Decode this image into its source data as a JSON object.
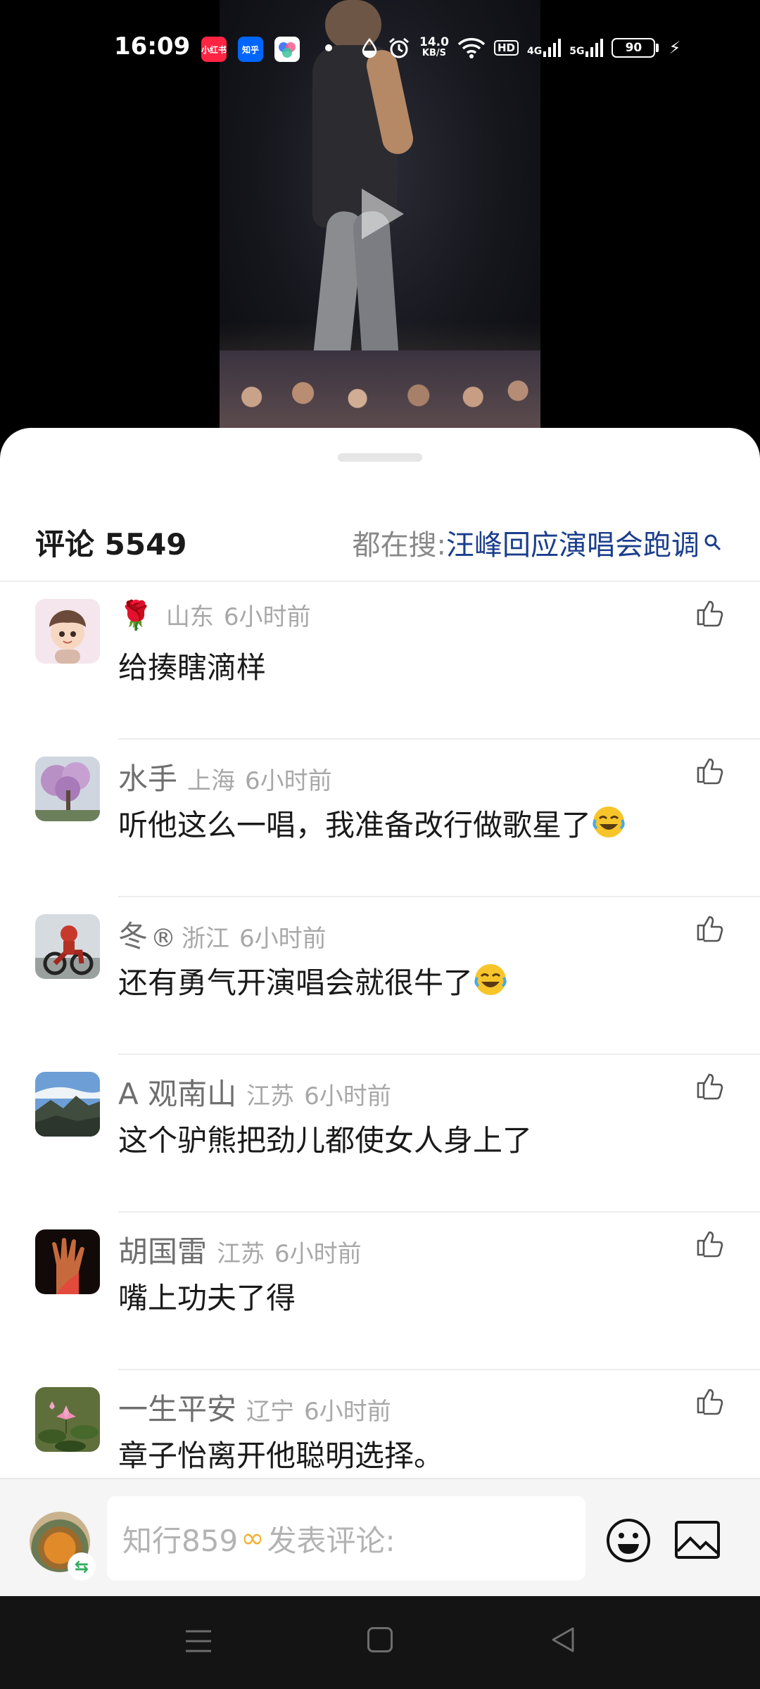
{
  "status_bar": {
    "time": "16:09",
    "apps": [
      {
        "icon": "xiaohongshu-icon",
        "label": "小红书",
        "color": "#ff2442"
      },
      {
        "icon": "zhihu-icon",
        "label": "知乎",
        "color": "#0066ff"
      },
      {
        "icon": "app-icon",
        "label": "",
        "color": "#ffffff"
      }
    ],
    "net_speed_value": "14.0",
    "net_speed_unit": "KB/S",
    "hd_label": "HD",
    "network_4g": "4G",
    "network_5g": "5G",
    "battery": "90"
  },
  "video": {
    "play_icon": "play-icon"
  },
  "sheet": {
    "title": "评论",
    "count": "5549",
    "search_prefix": "都在搜:",
    "search_term": "汪峰回应演唱会跑调"
  },
  "comments": [
    {
      "username": "",
      "badge": "rose",
      "location": "山东",
      "time": "6小时前",
      "text": "给揍瞎滴样",
      "emoji": false
    },
    {
      "username": "水手",
      "location": "上海",
      "time": "6小时前",
      "text": "听他这么一唱，我准备改行做歌星了",
      "emoji": true
    },
    {
      "username": "冬",
      "badge": "registered",
      "location": "浙江",
      "time": "6小时前",
      "text": "还有勇气开演唱会就很牛了",
      "emoji": true
    },
    {
      "username": "A 观南山",
      "location": "江苏",
      "time": "6小时前",
      "text": "这个驴熊把劲儿都使女人身上了",
      "emoji": false
    },
    {
      "username": "胡国雷",
      "location": "江苏",
      "time": "6小时前",
      "text": "嘴上功夫了得",
      "emoji": false
    },
    {
      "username": "一生平安",
      "location": "辽宁",
      "time": "6小时前",
      "text": "章子怡离开他聪明选择。",
      "emoji": false
    }
  ],
  "input": {
    "username": "知行859",
    "placeholder": "发表评论:",
    "switch_symbol": "⇆"
  },
  "colors": {
    "accent_link": "#1b3e8c",
    "like_icon": "#555555"
  }
}
